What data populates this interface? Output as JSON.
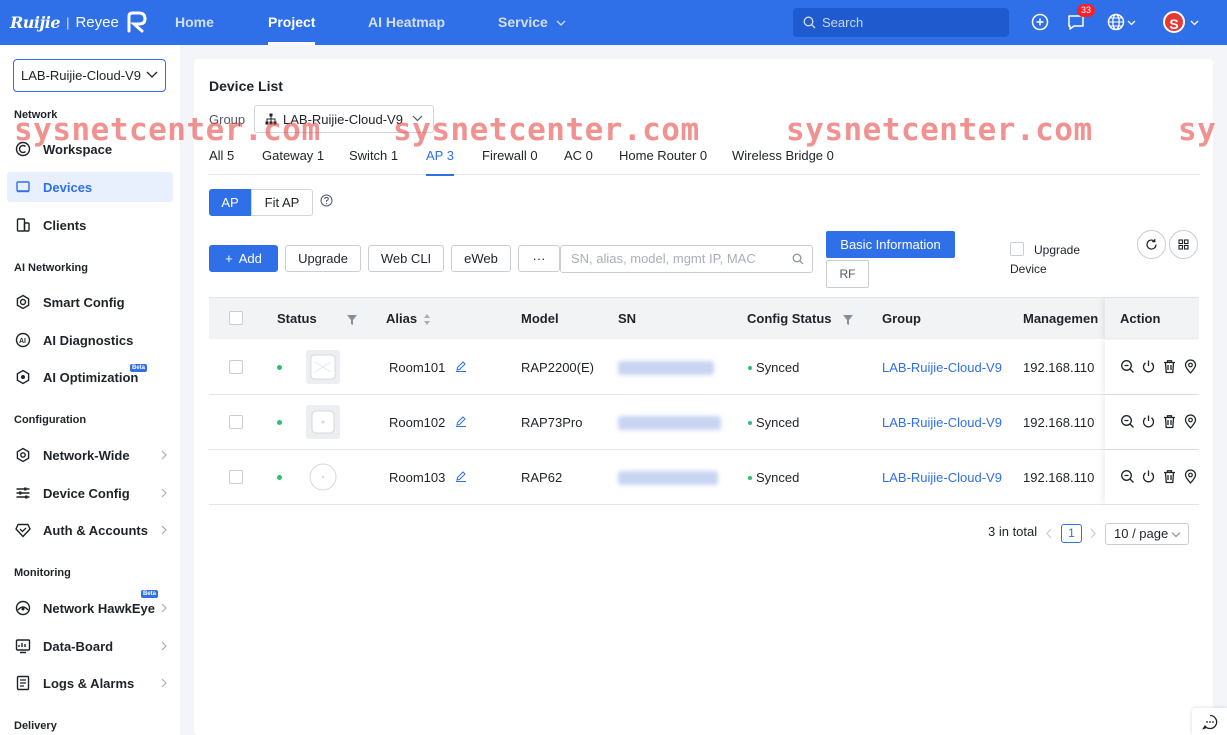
{
  "header": {
    "logo": "Ruijie",
    "logo_sub": "Reyee",
    "nav": [
      {
        "label": "Home"
      },
      {
        "label": "Project"
      },
      {
        "label": "AI Heatmap"
      },
      {
        "label": "Service"
      }
    ],
    "search_placeholder": "Search",
    "message_count": "33",
    "avatar_letter": "S"
  },
  "sidebar": {
    "selected_group": "LAB-Ruijie-Cloud-V9",
    "sections": {
      "network": "Network",
      "ai_networking": "AI Networking",
      "configuration": "Configuration",
      "monitoring": "Monitoring",
      "delivery": "Delivery"
    },
    "items": {
      "workspace": "Workspace",
      "devices": "Devices",
      "clients": "Clients",
      "smart_config": "Smart Config",
      "ai_diagnostics": "AI Diagnostics",
      "ai_optimization": "AI Optimization",
      "network_wide": "Network-Wide",
      "device_config": "Device Config",
      "auth_accounts": "Auth & Accounts",
      "network_hawkeye": "Network HawkEye",
      "data_board": "Data-Board",
      "logs_alarms": "Logs & Alarms"
    },
    "beta_label": "Beta"
  },
  "main": {
    "title": "Device List",
    "group_label": "Group",
    "group_value": "LAB-Ruijie-Cloud-V9",
    "tabs": [
      {
        "label": "All 5"
      },
      {
        "label": "Gateway 1"
      },
      {
        "label": "Switch 1"
      },
      {
        "label": "AP 3"
      },
      {
        "label": "Firewall 0"
      },
      {
        "label": "AC 0"
      },
      {
        "label": "Home Router 0"
      },
      {
        "label": "Wireless Bridge 0"
      }
    ],
    "segments": {
      "ap": "AP",
      "fit_ap": "Fit AP"
    },
    "toolbar": {
      "add": "Add",
      "upgrade": "Upgrade",
      "web_cli": "Web CLI",
      "eweb": "eWeb",
      "more": "···",
      "search_placeholder": "SN, alias, model, mgmt IP, MAC",
      "basic_info": "Basic Information",
      "rf": "RF",
      "upgrade_device": "Upgrade Device"
    },
    "columns": {
      "status": "Status",
      "alias": "Alias",
      "model": "Model",
      "sn": "SN",
      "config_status": "Config Status",
      "group": "Group",
      "management": "Managemen",
      "action": "Action"
    },
    "rows": [
      {
        "alias": "Room101",
        "model": "RAP2200(E)",
        "config": "Synced",
        "group": "LAB-Ruijie-Cloud-V9",
        "ip": "192.168.110"
      },
      {
        "alias": "Room102",
        "model": "RAP73Pro",
        "config": "Synced",
        "group": "LAB-Ruijie-Cloud-V9",
        "ip": "192.168.110"
      },
      {
        "alias": "Room103",
        "model": "RAP62",
        "config": "Synced",
        "group": "LAB-Ruijie-Cloud-V9",
        "ip": "192.168.110"
      }
    ],
    "pagination": {
      "total": "3 in total",
      "current_page": "1",
      "page_size": "10 / page"
    }
  },
  "watermark": "sysnetcenter.com",
  "colors": {
    "primary": "#2f6fe8",
    "online": "#2fbf71",
    "watermark": "#e53935"
  }
}
